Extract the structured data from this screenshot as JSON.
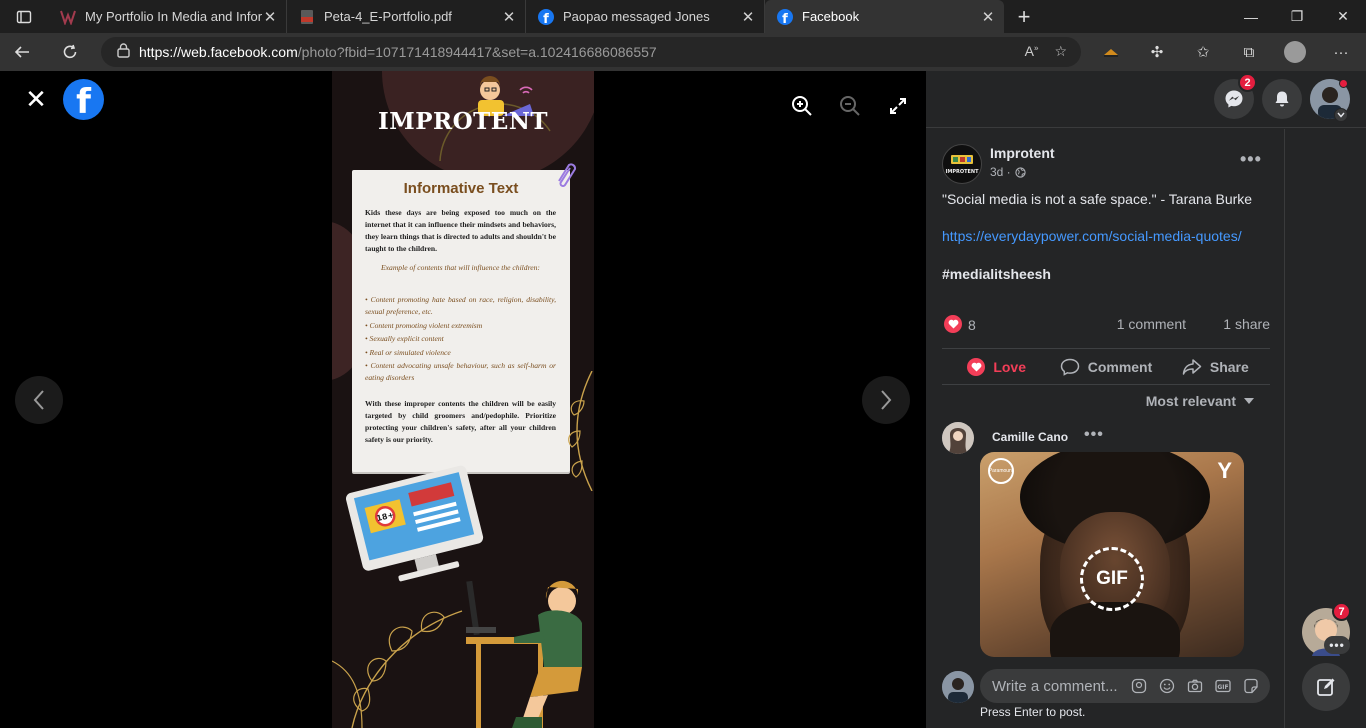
{
  "browser": {
    "tabs": [
      {
        "title": "My Portfolio In Media and Inform",
        "favicon": "portfolio-icon"
      },
      {
        "title": "Peta-4_E-Portfolio.pdf",
        "favicon": "pdf-icon"
      },
      {
        "title": "Paopao messaged Jones",
        "favicon": "facebook-icon"
      },
      {
        "title": "Facebook",
        "favicon": "facebook-icon",
        "active": true
      }
    ],
    "url_host": "https://web.facebook.com",
    "url_rest": "/photo?fbid=107171418944417&set=a.102416686086557"
  },
  "viewer": {
    "logo_glyph": "f",
    "close_glyph": "✕"
  },
  "poster": {
    "title": "IMPROTENT",
    "heading": "Informative Text",
    "intro": "Kids these days are being exposed too much on the internet that it can influence their mindsets and behaviors, they learn things that is directed to adults and shouldn't be taught to the children.",
    "example_heading": "Example of contents that will influence the children:",
    "bullets": [
      "• Content promoting hate based on race, religion, disability, sexual preference, etc.",
      "• Content promoting violent extremism",
      "• Sexually explicit content",
      "• Real or simulated violence",
      "• Content advocating unsafe behaviour, such as self-harm or eating disorders"
    ],
    "closing": "With these improper contents the children will be easily targeted by child groomers and/pedophile. Prioritize protecting your children's safety, after all your children safety is our priority.",
    "monitor_badge": "18+"
  },
  "header": {
    "messenger_badge": "2",
    "chat_badge": "7"
  },
  "post": {
    "page_name": "Improtent",
    "page_avatar_text": "IMPROTENT",
    "time": "3d ·",
    "text": "\"Social media is not a safe space.\" - Tarana Burke",
    "link": "https://everydaypower.com/social-media-quotes/",
    "hashtag": "#medialitsheesh",
    "reaction_count": "8",
    "comment_count": "1 comment",
    "share_count": "1 share",
    "actions": {
      "love": "Love",
      "comment": "Comment",
      "share": "Share"
    },
    "sort_label": "Most relevant",
    "comment": {
      "author": "Camille Cano",
      "gif_label": "GIF",
      "gif_brand_left": "Paramount",
      "gif_brand_right": "Y"
    },
    "write_placeholder": "Write a comment...",
    "press_enter": "Press Enter to post."
  },
  "colors": {
    "facebook_blue": "#1877f2",
    "love_red": "#f33e58",
    "link_blue": "#4599ff",
    "panel_bg": "#242526"
  }
}
